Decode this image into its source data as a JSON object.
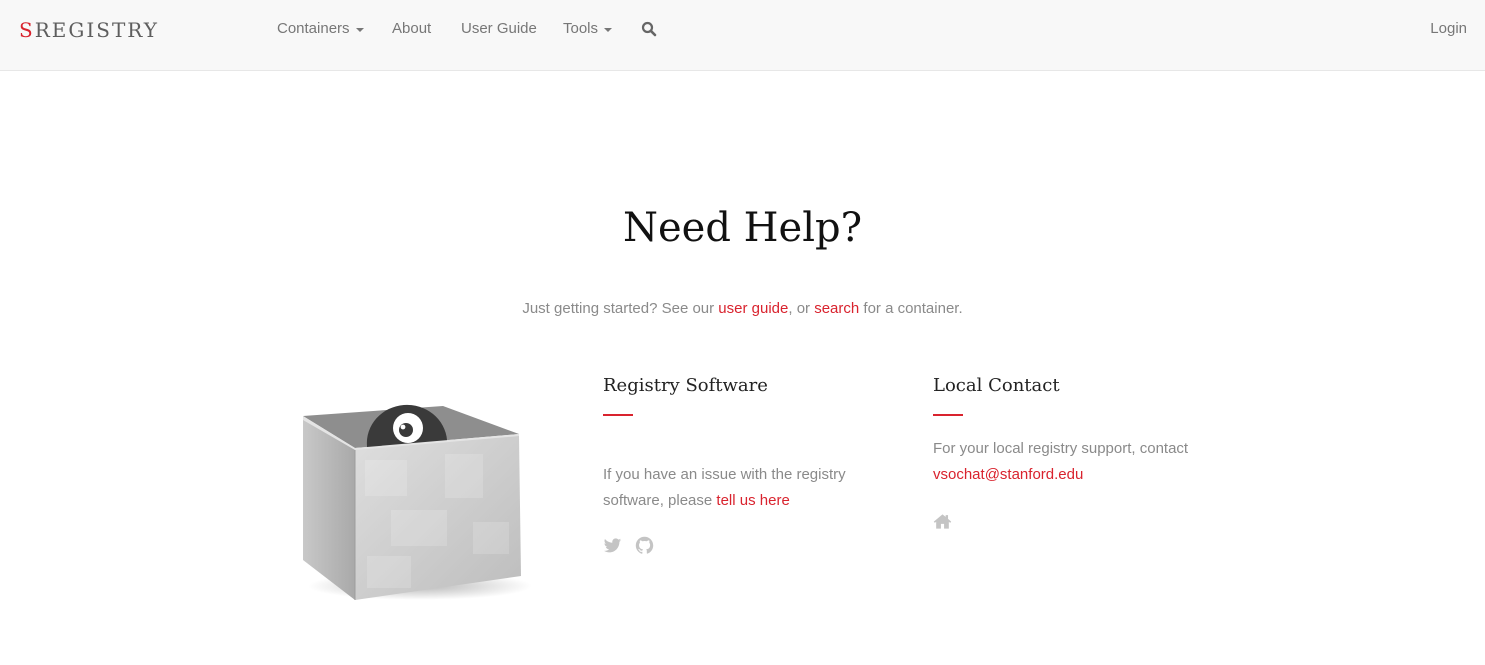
{
  "brand": {
    "first_letter": "S",
    "rest": "REGISTRY"
  },
  "nav": {
    "containers": "Containers",
    "about": "About",
    "user_guide": "User Guide",
    "tools": "Tools",
    "login": "Login",
    "search_icon": "search-icon"
  },
  "main": {
    "title": "Need Help?",
    "lead_prefix": "Just getting started? See our ",
    "lead_link1": "user guide",
    "lead_middle": ", or ",
    "lead_link2": "search",
    "lead_suffix": " for a container."
  },
  "registry_software": {
    "title": "Registry Software",
    "text_prefix": "If you have an issue with the registry software, please ",
    "link": "tell us here",
    "icons": [
      "twitter-icon",
      "github-icon"
    ]
  },
  "local_contact": {
    "title": "Local Contact",
    "text": "For your local registry support, contact",
    "email": "vsochat@stanford.edu",
    "icons": [
      "home-icon"
    ]
  },
  "colors": {
    "accent": "#d9232e",
    "navbar_bg": "#f8f8f8",
    "muted_text": "#8a8a8a",
    "icon_gray": "#c4c4c4"
  }
}
